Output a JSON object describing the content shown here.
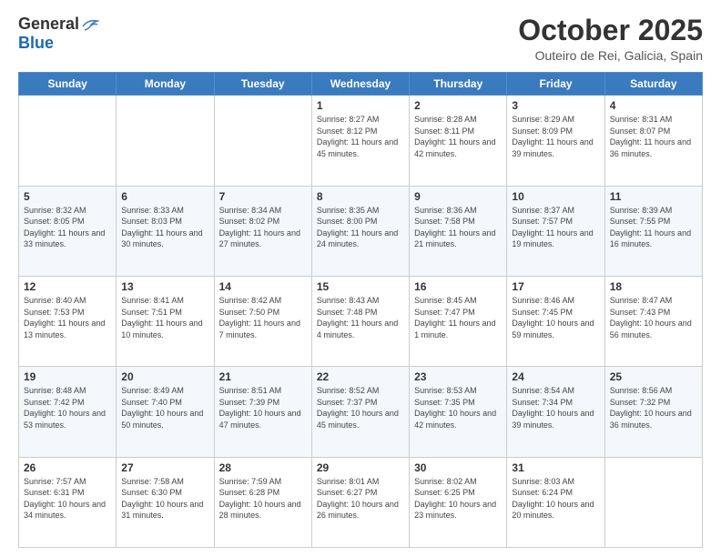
{
  "header": {
    "logo_general": "General",
    "logo_blue": "Blue",
    "month_title": "October 2025",
    "subtitle": "Outeiro de Rei, Galicia, Spain"
  },
  "days_of_week": [
    "Sunday",
    "Monday",
    "Tuesday",
    "Wednesday",
    "Thursday",
    "Friday",
    "Saturday"
  ],
  "weeks": [
    [
      {
        "day": "",
        "sunrise": "",
        "sunset": "",
        "daylight": ""
      },
      {
        "day": "",
        "sunrise": "",
        "sunset": "",
        "daylight": ""
      },
      {
        "day": "",
        "sunrise": "",
        "sunset": "",
        "daylight": ""
      },
      {
        "day": "1",
        "sunrise": "Sunrise: 8:27 AM",
        "sunset": "Sunset: 8:12 PM",
        "daylight": "Daylight: 11 hours and 45 minutes."
      },
      {
        "day": "2",
        "sunrise": "Sunrise: 8:28 AM",
        "sunset": "Sunset: 8:11 PM",
        "daylight": "Daylight: 11 hours and 42 minutes."
      },
      {
        "day": "3",
        "sunrise": "Sunrise: 8:29 AM",
        "sunset": "Sunset: 8:09 PM",
        "daylight": "Daylight: 11 hours and 39 minutes."
      },
      {
        "day": "4",
        "sunrise": "Sunrise: 8:31 AM",
        "sunset": "Sunset: 8:07 PM",
        "daylight": "Daylight: 11 hours and 36 minutes."
      }
    ],
    [
      {
        "day": "5",
        "sunrise": "Sunrise: 8:32 AM",
        "sunset": "Sunset: 8:05 PM",
        "daylight": "Daylight: 11 hours and 33 minutes."
      },
      {
        "day": "6",
        "sunrise": "Sunrise: 8:33 AM",
        "sunset": "Sunset: 8:03 PM",
        "daylight": "Daylight: 11 hours and 30 minutes."
      },
      {
        "day": "7",
        "sunrise": "Sunrise: 8:34 AM",
        "sunset": "Sunset: 8:02 PM",
        "daylight": "Daylight: 11 hours and 27 minutes."
      },
      {
        "day": "8",
        "sunrise": "Sunrise: 8:35 AM",
        "sunset": "Sunset: 8:00 PM",
        "daylight": "Daylight: 11 hours and 24 minutes."
      },
      {
        "day": "9",
        "sunrise": "Sunrise: 8:36 AM",
        "sunset": "Sunset: 7:58 PM",
        "daylight": "Daylight: 11 hours and 21 minutes."
      },
      {
        "day": "10",
        "sunrise": "Sunrise: 8:37 AM",
        "sunset": "Sunset: 7:57 PM",
        "daylight": "Daylight: 11 hours and 19 minutes."
      },
      {
        "day": "11",
        "sunrise": "Sunrise: 8:39 AM",
        "sunset": "Sunset: 7:55 PM",
        "daylight": "Daylight: 11 hours and 16 minutes."
      }
    ],
    [
      {
        "day": "12",
        "sunrise": "Sunrise: 8:40 AM",
        "sunset": "Sunset: 7:53 PM",
        "daylight": "Daylight: 11 hours and 13 minutes."
      },
      {
        "day": "13",
        "sunrise": "Sunrise: 8:41 AM",
        "sunset": "Sunset: 7:51 PM",
        "daylight": "Daylight: 11 hours and 10 minutes."
      },
      {
        "day": "14",
        "sunrise": "Sunrise: 8:42 AM",
        "sunset": "Sunset: 7:50 PM",
        "daylight": "Daylight: 11 hours and 7 minutes."
      },
      {
        "day": "15",
        "sunrise": "Sunrise: 8:43 AM",
        "sunset": "Sunset: 7:48 PM",
        "daylight": "Daylight: 11 hours and 4 minutes."
      },
      {
        "day": "16",
        "sunrise": "Sunrise: 8:45 AM",
        "sunset": "Sunset: 7:47 PM",
        "daylight": "Daylight: 11 hours and 1 minute."
      },
      {
        "day": "17",
        "sunrise": "Sunrise: 8:46 AM",
        "sunset": "Sunset: 7:45 PM",
        "daylight": "Daylight: 10 hours and 59 minutes."
      },
      {
        "day": "18",
        "sunrise": "Sunrise: 8:47 AM",
        "sunset": "Sunset: 7:43 PM",
        "daylight": "Daylight: 10 hours and 56 minutes."
      }
    ],
    [
      {
        "day": "19",
        "sunrise": "Sunrise: 8:48 AM",
        "sunset": "Sunset: 7:42 PM",
        "daylight": "Daylight: 10 hours and 53 minutes."
      },
      {
        "day": "20",
        "sunrise": "Sunrise: 8:49 AM",
        "sunset": "Sunset: 7:40 PM",
        "daylight": "Daylight: 10 hours and 50 minutes."
      },
      {
        "day": "21",
        "sunrise": "Sunrise: 8:51 AM",
        "sunset": "Sunset: 7:39 PM",
        "daylight": "Daylight: 10 hours and 47 minutes."
      },
      {
        "day": "22",
        "sunrise": "Sunrise: 8:52 AM",
        "sunset": "Sunset: 7:37 PM",
        "daylight": "Daylight: 10 hours and 45 minutes."
      },
      {
        "day": "23",
        "sunrise": "Sunrise: 8:53 AM",
        "sunset": "Sunset: 7:35 PM",
        "daylight": "Daylight: 10 hours and 42 minutes."
      },
      {
        "day": "24",
        "sunrise": "Sunrise: 8:54 AM",
        "sunset": "Sunset: 7:34 PM",
        "daylight": "Daylight: 10 hours and 39 minutes."
      },
      {
        "day": "25",
        "sunrise": "Sunrise: 8:56 AM",
        "sunset": "Sunset: 7:32 PM",
        "daylight": "Daylight: 10 hours and 36 minutes."
      }
    ],
    [
      {
        "day": "26",
        "sunrise": "Sunrise: 7:57 AM",
        "sunset": "Sunset: 6:31 PM",
        "daylight": "Daylight: 10 hours and 34 minutes."
      },
      {
        "day": "27",
        "sunrise": "Sunrise: 7:58 AM",
        "sunset": "Sunset: 6:30 PM",
        "daylight": "Daylight: 10 hours and 31 minutes."
      },
      {
        "day": "28",
        "sunrise": "Sunrise: 7:59 AM",
        "sunset": "Sunset: 6:28 PM",
        "daylight": "Daylight: 10 hours and 28 minutes."
      },
      {
        "day": "29",
        "sunrise": "Sunrise: 8:01 AM",
        "sunset": "Sunset: 6:27 PM",
        "daylight": "Daylight: 10 hours and 26 minutes."
      },
      {
        "day": "30",
        "sunrise": "Sunrise: 8:02 AM",
        "sunset": "Sunset: 6:25 PM",
        "daylight": "Daylight: 10 hours and 23 minutes."
      },
      {
        "day": "31",
        "sunrise": "Sunrise: 8:03 AM",
        "sunset": "Sunset: 6:24 PM",
        "daylight": "Daylight: 10 hours and 20 minutes."
      },
      {
        "day": "",
        "sunrise": "",
        "sunset": "",
        "daylight": ""
      }
    ]
  ]
}
